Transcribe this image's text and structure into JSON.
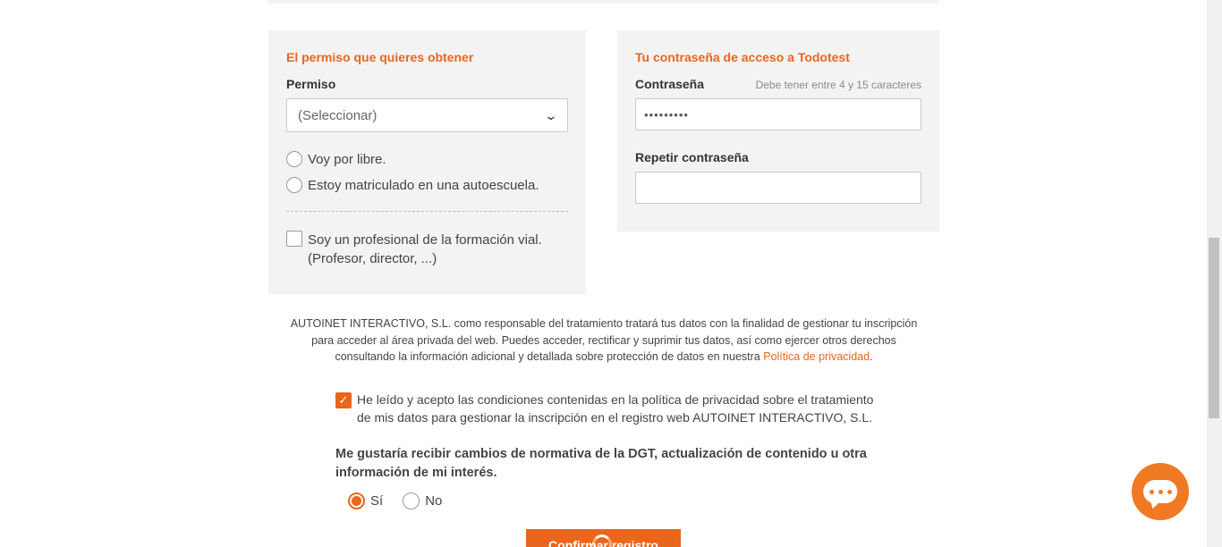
{
  "colors": {
    "accent": "#e9661d",
    "panel_bg": "#f3f3f3",
    "text": "#333333"
  },
  "permit_panel": {
    "title": "El permiso que quieres obtener",
    "permit_label": "Permiso",
    "permit_select_value": "(Seleccionar)",
    "options": [
      {
        "label": "Voy por libre.",
        "checked": false
      },
      {
        "label": "Estoy matriculado en una autoescuela.",
        "checked": false
      }
    ],
    "professional_line1": "Soy un profesional de la formación vial.",
    "professional_line2": "(Profesor, director, ...)",
    "professional_checked": false
  },
  "password_panel": {
    "title": "Tu contraseña de acceso a Todotest",
    "password_label": "Contraseña",
    "password_hint": "Debe tener entre 4 y 15 caracteres",
    "password_value": "•••••••••",
    "repeat_label": "Repetir contraseña",
    "repeat_value": ""
  },
  "legal": {
    "line1": "AUTOINET INTERACTIVO, S.L. como responsable del tratamiento tratará tus datos con la finalidad de gestionar tu inscripción",
    "line2": "para acceder al área privada del web. Puedes acceder, rectificar y suprimir tus datos, así como ejercer otros derechos",
    "line3": "consultando la información adicional y detallada sobre protección de datos en nuestra",
    "link": "Política de privacidad",
    "end": "."
  },
  "accept": {
    "checked": true,
    "line1": "He leído y acepto las condiciones contenidas en la política de privacidad sobre el tratamiento",
    "line2": "de mis datos para gestionar la inscripción en el registro web AUTOINET INTERACTIVO, S.L."
  },
  "newsletter": {
    "question_line1": "Me gustaría recibir cambios de normativa de la DGT, actualización de contenido u otra",
    "question_line2": "información de mi interés.",
    "yes_label": "Sí",
    "no_label": "No",
    "selected": "Sí"
  },
  "submit_label": "Confirmar registro",
  "chat_icon": "chat-bubble-icon"
}
